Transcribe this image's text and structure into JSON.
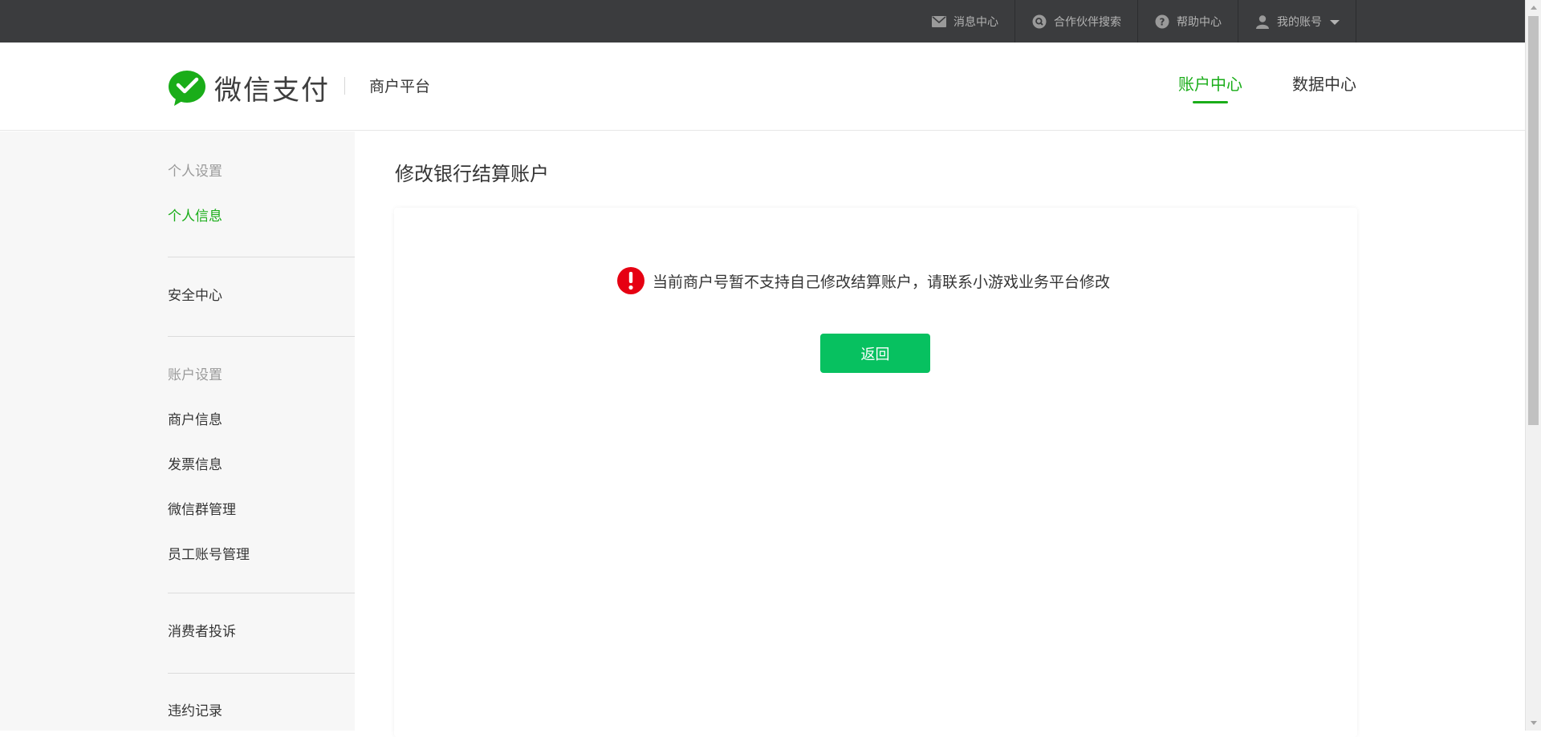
{
  "topbar": {
    "items": [
      {
        "label": "消息中心",
        "icon": "mail-icon"
      },
      {
        "label": "合作伙伴搜索",
        "icon": "search-icon"
      },
      {
        "label": "帮助中心",
        "icon": "help-icon"
      },
      {
        "label": "我的账号",
        "icon": "user-icon"
      }
    ]
  },
  "header": {
    "logo_text": "微信支付",
    "platform": "商户平台",
    "nav": [
      {
        "label": "账户中心",
        "active": true
      },
      {
        "label": "数据中心",
        "active": false
      }
    ]
  },
  "sidebar": {
    "personal_heading": "个人设置",
    "personal_info": "个人信息",
    "security_center": "安全中心",
    "account_heading": "账户设置",
    "merchant_info": "商户信息",
    "invoice_info": "发票信息",
    "wechat_group": "微信群管理",
    "staff_accounts": "员工账号管理",
    "consumer_complaints": "消费者投诉",
    "violation_records": "违约记录"
  },
  "main": {
    "title": "修改银行结算账户",
    "notice": "当前商户号暂不支持自己修改结算账户，请联系小游戏业务平台修改",
    "back_label": "返回"
  },
  "colors": {
    "brand_green": "#1aad19",
    "button_green": "#07c160",
    "alert_red": "#e60012",
    "topbar_bg": "#3b3c3e"
  }
}
